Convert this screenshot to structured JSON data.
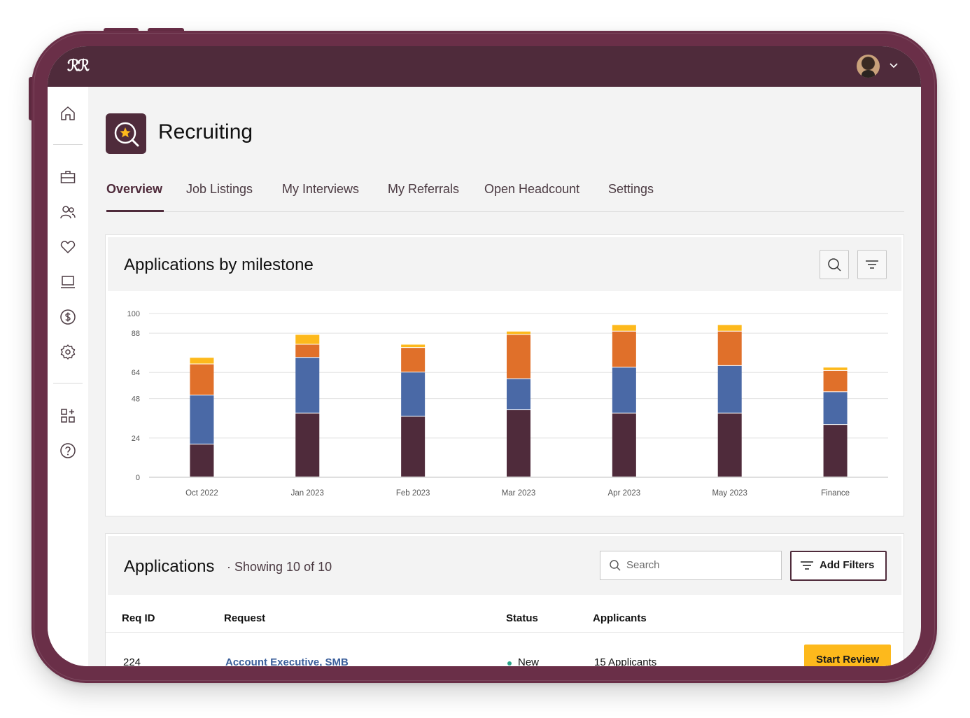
{
  "topbar": {
    "logo_text": "ℛℛ",
    "avatar_icon": "user-avatar",
    "menu_icon": "chevron-down-icon"
  },
  "sidebar": {
    "items": [
      {
        "icon": "home-icon"
      },
      {
        "icon": "briefcase-icon"
      },
      {
        "icon": "people-icon"
      },
      {
        "icon": "heart-icon"
      },
      {
        "icon": "laptop-icon"
      },
      {
        "icon": "dollar-icon"
      },
      {
        "icon": "settings-icon"
      },
      {
        "icon": "apps-add-icon"
      },
      {
        "icon": "help-icon"
      }
    ]
  },
  "page": {
    "title": "Recruiting",
    "app_icon": "search-star-icon"
  },
  "tabs": [
    "Overview",
    "Job Listings",
    "My Interviews",
    "My Referrals",
    "Open Headcount",
    "Settings"
  ],
  "active_tab": "Overview",
  "chart_card": {
    "title": "Applications by milestone",
    "search_icon": "search-icon",
    "filter_icon": "filter-icon"
  },
  "chart_data": {
    "type": "bar",
    "stacked": true,
    "title": "Applications by milestone",
    "categories": [
      "Oct 2022",
      "Jan 2023",
      "Feb 2023",
      "Mar 2023",
      "Apr 2023",
      "May 2023",
      "Finance"
    ],
    "y_ticks": [
      0,
      24,
      48,
      64,
      88,
      100
    ],
    "ylim": [
      0,
      100
    ],
    "grid": true,
    "series": [
      {
        "values": [
          20,
          39,
          37,
          41,
          39,
          39,
          32
        ],
        "color": "#4f2b3b"
      },
      {
        "values": [
          30,
          34,
          27,
          19,
          28,
          29,
          20
        ],
        "color": "#4a69a6"
      },
      {
        "values": [
          19,
          8,
          15,
          27,
          22,
          21,
          13
        ],
        "color": "#e0702a"
      },
      {
        "values": [
          4,
          6,
          2,
          2,
          4,
          4,
          2
        ],
        "color": "#fdb91c"
      }
    ]
  },
  "applications": {
    "title": "Applications",
    "subtitle": "· Showing 10 of 10",
    "search_placeholder": "Search",
    "add_filters_label": "Add Filters",
    "columns": [
      "Req ID",
      "Request",
      "Status",
      "Applicants"
    ],
    "rows": [
      {
        "req_id": "224",
        "request": "Account Executive, SMB",
        "status": "New",
        "applicants": "15 Applicants",
        "action": "Start Review"
      }
    ],
    "status_color": "#2aa48a"
  },
  "colors": {
    "brand": "#4f2b3b",
    "accent": "#fdb91c",
    "device_frame": "#6a2f48"
  }
}
